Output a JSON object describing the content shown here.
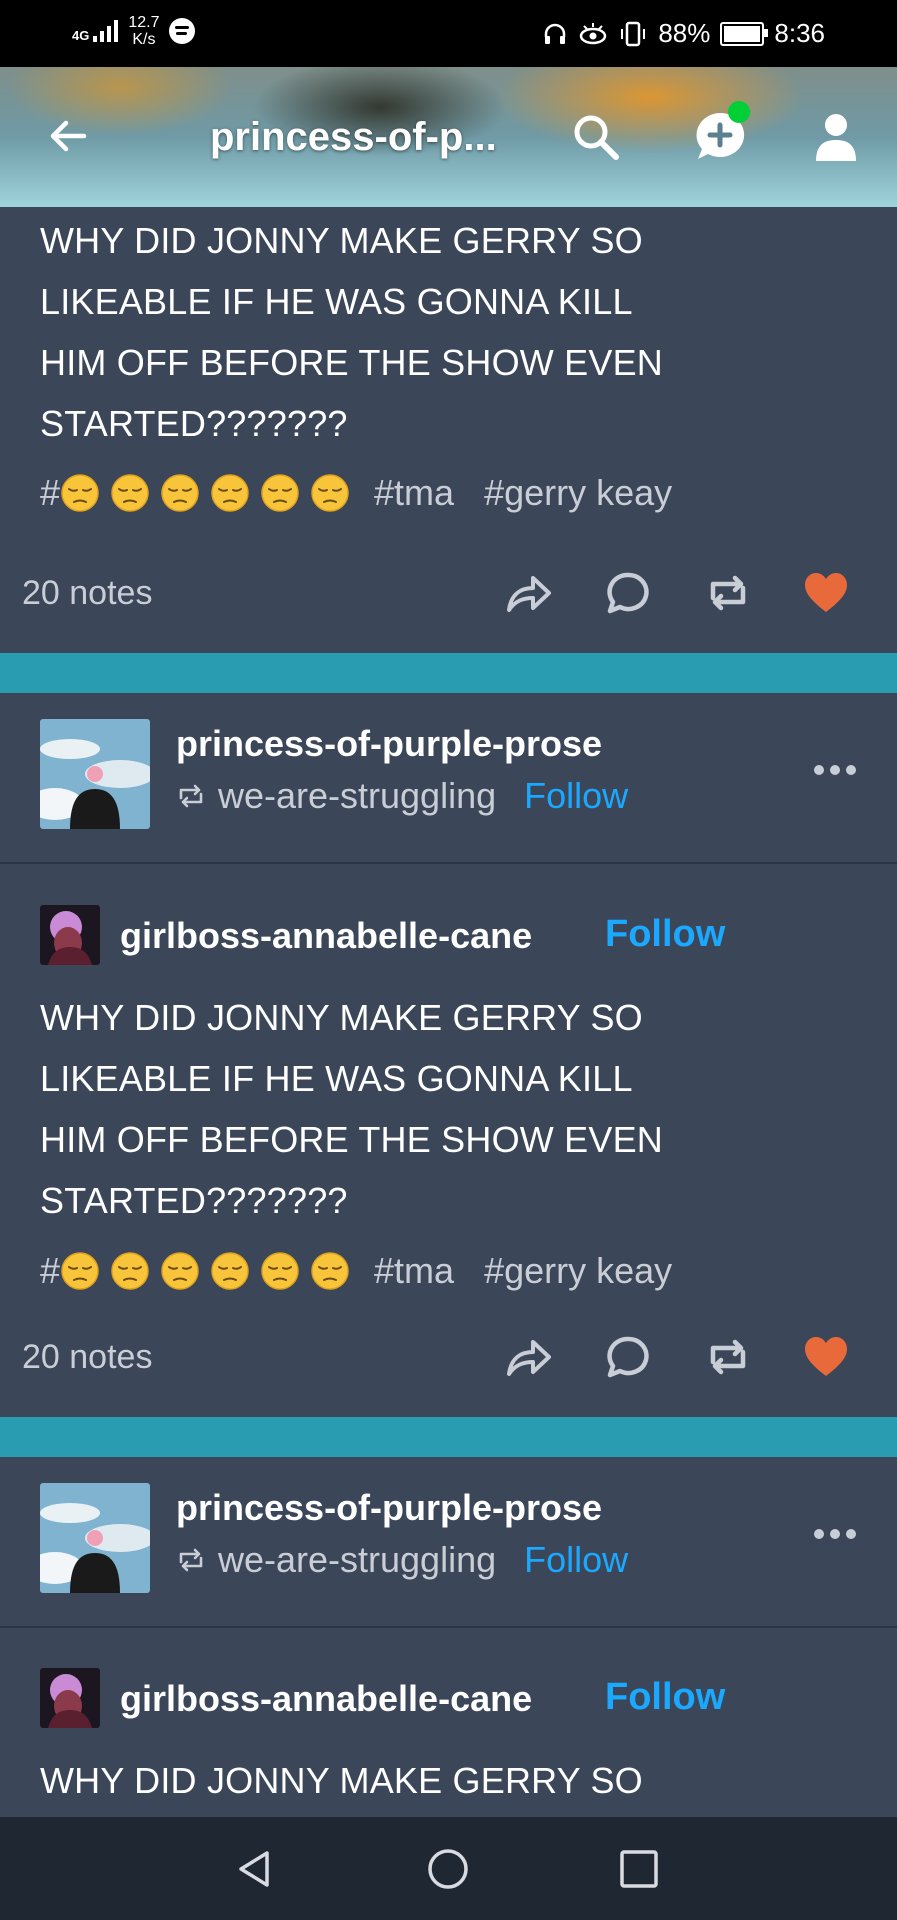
{
  "status_bar": {
    "network": "4G",
    "speed_value": "12.7",
    "speed_unit": "K/s",
    "battery": "88%",
    "time": "8:36"
  },
  "header": {
    "title": "princess-of-p..."
  },
  "post_text": "WHY DID JONNY MAKE GERRY SO LIKEABLE IF HE WAS GONNA KILL HIM OFF BEFORE THE SHOW EVEN STARTED???????",
  "post_lines": [
    "WHY DID JONNY MAKE GERRY SO",
    "LIKEABLE IF HE WAS GONNA KILL",
    "HIM OFF BEFORE THE SHOW EVEN",
    "STARTED???????"
  ],
  "tags": {
    "hash": "#",
    "emoji_count": 6,
    "emoji_name": "pensive-face",
    "tag1": "#tma",
    "tag2": "#gerry keay"
  },
  "notes_label": "20 notes",
  "reblogger": {
    "name": "princess-of-purple-prose",
    "reblogged_from": "we-are-struggling",
    "follow_label": "Follow"
  },
  "original_poster": {
    "name": "girlboss-annabelle-cane",
    "follow_label": "Follow"
  },
  "colors": {
    "background": "#3b4659",
    "separator": "#2a9cb2",
    "follow": "#1ba8ff",
    "like": "#e86a3a",
    "new_dot": "#00cf35"
  }
}
